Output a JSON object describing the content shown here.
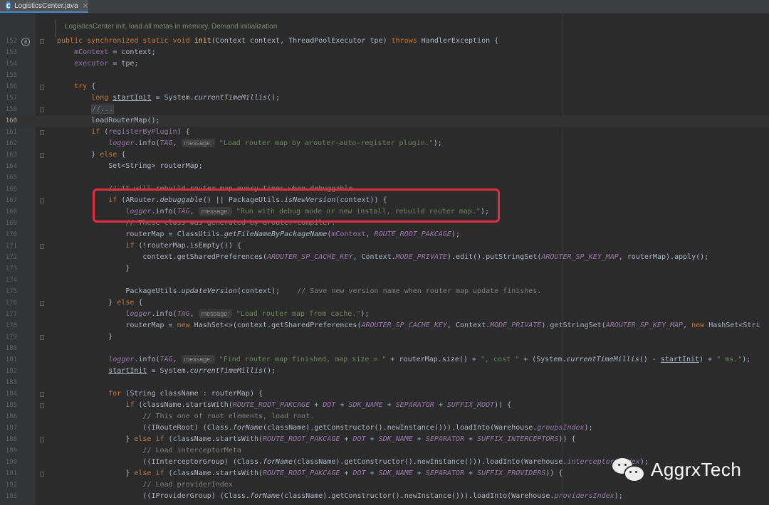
{
  "tab": {
    "icon": "C",
    "name": "LogisticsCenter.java",
    "close": "×"
  },
  "doc_comment": {
    "text": "LogisticsCenter init, load all metas in memory. Demand initialization"
  },
  "watermark": {
    "text": "AggrxTech"
  },
  "code_lines": [
    {
      "n": "152",
      "t": [
        [
          "public synchronized static void ",
          "kw"
        ],
        [
          "init",
          "fn"
        ],
        [
          "(Context context, ThreadPoolExecutor tpe) ",
          ""
        ],
        [
          "throws ",
          "kw"
        ],
        [
          "HandlerException {",
          ""
        ]
      ]
    },
    {
      "n": "153",
      "t": [
        [
          "    ",
          ""
        ],
        [
          "mContext",
          "fld"
        ],
        [
          " = context;",
          ""
        ]
      ]
    },
    {
      "n": "154",
      "t": [
        [
          "    ",
          ""
        ],
        [
          "executor",
          "fld"
        ],
        [
          " = tpe;",
          ""
        ]
      ]
    },
    {
      "n": "155",
      "t": []
    },
    {
      "n": "156",
      "t": [
        [
          "    ",
          ""
        ],
        [
          "try ",
          "kw"
        ],
        [
          "{",
          ""
        ]
      ]
    },
    {
      "n": "157",
      "t": [
        [
          "        ",
          ""
        ],
        [
          "long ",
          "kw"
        ],
        [
          "startInit",
          "ul"
        ],
        [
          " = System.",
          ""
        ],
        [
          "currentTimeMillis",
          "sm"
        ],
        [
          "();",
          ""
        ]
      ]
    },
    {
      "n": "158",
      "t": [
        [
          "        ",
          ""
        ],
        [
          "//...",
          "folded"
        ]
      ]
    },
    {
      "n": "160",
      "t": [
        [
          "        loadRouterMap();",
          ""
        ]
      ]
    },
    {
      "n": "161",
      "t": [
        [
          "        ",
          ""
        ],
        [
          "if ",
          "kw"
        ],
        [
          "(",
          ""
        ],
        [
          "registerByPlugin",
          "fld"
        ],
        [
          ") {",
          ""
        ]
      ]
    },
    {
      "n": "162",
      "t": [
        [
          "            ",
          ""
        ],
        [
          "logger",
          "ist"
        ],
        [
          ".info(",
          ""
        ],
        [
          "TAG",
          "ist"
        ],
        [
          ", ",
          ""
        ],
        [
          "message:",
          "hint"
        ],
        [
          " ",
          ""
        ],
        [
          "\"Load router map by arouter-auto-register plugin.\"",
          "str"
        ],
        [
          ");",
          ""
        ]
      ]
    },
    {
      "n": "163",
      "t": [
        [
          "        } ",
          ""
        ],
        [
          "else ",
          "kw"
        ],
        [
          "{",
          ""
        ]
      ]
    },
    {
      "n": "164",
      "t": [
        [
          "            Set<String> routerMap;",
          ""
        ]
      ]
    },
    {
      "n": "165",
      "t": []
    },
    {
      "n": "166",
      "t": [
        [
          "            ",
          ""
        ],
        [
          "// It will rebuild router map every times when debuggable.",
          "cmt"
        ]
      ]
    },
    {
      "n": "167",
      "t": [
        [
          "            ",
          ""
        ],
        [
          "if ",
          "kw"
        ],
        [
          "(ARouter.",
          ""
        ],
        [
          "debuggable",
          "sm"
        ],
        [
          "() || PackageUtils.",
          ""
        ],
        [
          "isNewVersion",
          "sm"
        ],
        [
          "(context)) {",
          ""
        ]
      ]
    },
    {
      "n": "168",
      "t": [
        [
          "                ",
          ""
        ],
        [
          "logger",
          "ist"
        ],
        [
          ".info(",
          ""
        ],
        [
          "TAG",
          "ist"
        ],
        [
          ", ",
          ""
        ],
        [
          "message:",
          "hint"
        ],
        [
          " ",
          ""
        ],
        [
          "\"Run with debug mode or new install, rebuild router map.\"",
          "str"
        ],
        [
          ");",
          ""
        ]
      ]
    },
    {
      "n": "169",
      "t": [
        [
          "                ",
          ""
        ],
        [
          "// These class was generated by arouter-compiler.",
          "cmt"
        ]
      ]
    },
    {
      "n": "170",
      "t": [
        [
          "                routerMap = ClassUtils.",
          ""
        ],
        [
          "getFileNameByPackageName",
          "sm"
        ],
        [
          "(",
          ""
        ],
        [
          "mContext",
          "fld"
        ],
        [
          ", ",
          ""
        ],
        [
          "ROUTE_ROOT_PAKCAGE",
          "ist"
        ],
        [
          ");",
          ""
        ]
      ]
    },
    {
      "n": "171",
      "t": [
        [
          "                ",
          ""
        ],
        [
          "if ",
          "kw"
        ],
        [
          "(!routerMap.isEmpty()) {",
          ""
        ]
      ]
    },
    {
      "n": "172",
      "t": [
        [
          "                    context.getSharedPreferences(",
          ""
        ],
        [
          "AROUTER_SP_CACHE_KEY",
          "ist"
        ],
        [
          ", Context.",
          ""
        ],
        [
          "MODE_PRIVATE",
          "ist"
        ],
        [
          ").edit().putStringSet(",
          ""
        ],
        [
          "AROUTER_SP_KEY_MAP",
          "ist"
        ],
        [
          ", routerMap).apply();",
          ""
        ]
      ]
    },
    {
      "n": "173",
      "t": [
        [
          "                }",
          ""
        ]
      ]
    },
    {
      "n": "174",
      "t": []
    },
    {
      "n": "175",
      "t": [
        [
          "                PackageUtils.",
          ""
        ],
        [
          "updateVersion",
          "sm"
        ],
        [
          "(context);    ",
          ""
        ],
        [
          "// Save new version name when router map update finishes.",
          "cmt"
        ]
      ]
    },
    {
      "n": "176",
      "t": [
        [
          "            } ",
          ""
        ],
        [
          "else ",
          "kw"
        ],
        [
          "{",
          ""
        ]
      ]
    },
    {
      "n": "177",
      "t": [
        [
          "                ",
          ""
        ],
        [
          "logger",
          "ist"
        ],
        [
          ".info(",
          ""
        ],
        [
          "TAG",
          "ist"
        ],
        [
          ", ",
          ""
        ],
        [
          "message:",
          "hint"
        ],
        [
          " ",
          ""
        ],
        [
          "\"Load router map from cache.\"",
          "str"
        ],
        [
          ");",
          ""
        ]
      ]
    },
    {
      "n": "178",
      "t": [
        [
          "                routerMap = ",
          ""
        ],
        [
          "new ",
          "kw"
        ],
        [
          "HashSet<>(context.getSharedPreferences(",
          ""
        ],
        [
          "AROUTER_SP_CACHE_KEY",
          "ist"
        ],
        [
          ", Context.",
          ""
        ],
        [
          "MODE_PRIVATE",
          "ist"
        ],
        [
          ").getStringSet(",
          ""
        ],
        [
          "AROUTER_SP_KEY_MAP",
          "ist"
        ],
        [
          ", ",
          ""
        ],
        [
          "new ",
          "kw"
        ],
        [
          "HashSet<Stri",
          ""
        ]
      ]
    },
    {
      "n": "179",
      "t": [
        [
          "            }",
          ""
        ]
      ]
    },
    {
      "n": "180",
      "t": []
    },
    {
      "n": "181",
      "t": [
        [
          "            ",
          ""
        ],
        [
          "logger",
          "ist"
        ],
        [
          ".info(",
          ""
        ],
        [
          "TAG",
          "ist"
        ],
        [
          ", ",
          ""
        ],
        [
          "message:",
          "hint"
        ],
        [
          " ",
          ""
        ],
        [
          "\"Find router map finished, map size = \"",
          "str"
        ],
        [
          " + routerMap.size() + ",
          ""
        ],
        [
          "\", cost \"",
          "str"
        ],
        [
          " + (System.",
          ""
        ],
        [
          "currentTimeMillis",
          "sm"
        ],
        [
          "() - ",
          ""
        ],
        [
          "startInit",
          "ul"
        ],
        [
          ") + ",
          ""
        ],
        [
          "\" ms.\"",
          "str"
        ],
        [
          ");",
          ""
        ]
      ]
    },
    {
      "n": "182",
      "t": [
        [
          "            ",
          ""
        ],
        [
          "startInit",
          "ul"
        ],
        [
          " = System.",
          ""
        ],
        [
          "currentTimeMillis",
          "sm"
        ],
        [
          "();",
          ""
        ]
      ]
    },
    {
      "n": "183",
      "t": []
    },
    {
      "n": "184",
      "t": [
        [
          "            ",
          ""
        ],
        [
          "for ",
          "kw"
        ],
        [
          "(String className : routerMap) {",
          ""
        ]
      ]
    },
    {
      "n": "185",
      "t": [
        [
          "                ",
          ""
        ],
        [
          "if ",
          "kw"
        ],
        [
          "(className.startsWith(",
          ""
        ],
        [
          "ROUTE_ROOT_PAKCAGE",
          "ist"
        ],
        [
          " + ",
          ""
        ],
        [
          "DOT",
          "ist"
        ],
        [
          " + ",
          ""
        ],
        [
          "SDK_NAME",
          "ist"
        ],
        [
          " + ",
          ""
        ],
        [
          "SEPARATOR",
          "ist"
        ],
        [
          " + ",
          ""
        ],
        [
          "SUFFIX_ROOT",
          "ist"
        ],
        [
          ")) {",
          ""
        ]
      ]
    },
    {
      "n": "186",
      "t": [
        [
          "                    ",
          ""
        ],
        [
          "// This one of root elements, load root.",
          "cmt"
        ]
      ]
    },
    {
      "n": "187",
      "t": [
        [
          "                    ((IRouteRoot) (Class.",
          ""
        ],
        [
          "forName",
          "sm"
        ],
        [
          "(className).getConstructor().newInstance())).loadInto(Warehouse.",
          ""
        ],
        [
          "groupsIndex",
          "ist"
        ],
        [
          ");",
          ""
        ]
      ]
    },
    {
      "n": "188",
      "t": [
        [
          "                } ",
          ""
        ],
        [
          "else if ",
          "kw"
        ],
        [
          "(className.startsWith(",
          ""
        ],
        [
          "ROUTE_ROOT_PAKCAGE",
          "ist"
        ],
        [
          " + ",
          ""
        ],
        [
          "DOT",
          "ist"
        ],
        [
          " + ",
          ""
        ],
        [
          "SDK_NAME",
          "ist"
        ],
        [
          " + ",
          ""
        ],
        [
          "SEPARATOR",
          "ist"
        ],
        [
          " + ",
          ""
        ],
        [
          "SUFFIX_INTERCEPTORS",
          "ist"
        ],
        [
          ")) {",
          ""
        ]
      ]
    },
    {
      "n": "189",
      "t": [
        [
          "                    ",
          ""
        ],
        [
          "// Load interceptorMeta",
          "cmt"
        ]
      ]
    },
    {
      "n": "190",
      "t": [
        [
          "                    ((IInterceptorGroup) (Class.",
          ""
        ],
        [
          "forName",
          "sm"
        ],
        [
          "(className).getConstructor().newInstance())).loadInto(Warehouse.",
          ""
        ],
        [
          "interceptorsIndex",
          "ist"
        ],
        [
          ");",
          ""
        ]
      ]
    },
    {
      "n": "191",
      "t": [
        [
          "                } ",
          ""
        ],
        [
          "else if ",
          "kw"
        ],
        [
          "(className.startsWith(",
          ""
        ],
        [
          "ROUTE_ROOT_PAKCAGE",
          "ist"
        ],
        [
          " + ",
          ""
        ],
        [
          "DOT",
          "ist"
        ],
        [
          " + ",
          ""
        ],
        [
          "SDK_NAME",
          "ist"
        ],
        [
          " + ",
          ""
        ],
        [
          "SEPARATOR",
          "ist"
        ],
        [
          " + ",
          ""
        ],
        [
          "SUFFIX_PROVIDERS",
          "ist"
        ],
        [
          ")) {",
          ""
        ]
      ]
    },
    {
      "n": "192",
      "t": [
        [
          "                    ",
          ""
        ],
        [
          "// Load providerIndex",
          "cmt"
        ]
      ]
    },
    {
      "n": "193",
      "t": [
        [
          "                    ((IProviderGroup) (Class.",
          ""
        ],
        [
          "forName",
          "sm"
        ],
        [
          "(className).getConstructor().newInstance())).loadInto(Warehouse.",
          ""
        ],
        [
          "providersIndex",
          "ist"
        ],
        [
          ");",
          ""
        ]
      ]
    }
  ]
}
